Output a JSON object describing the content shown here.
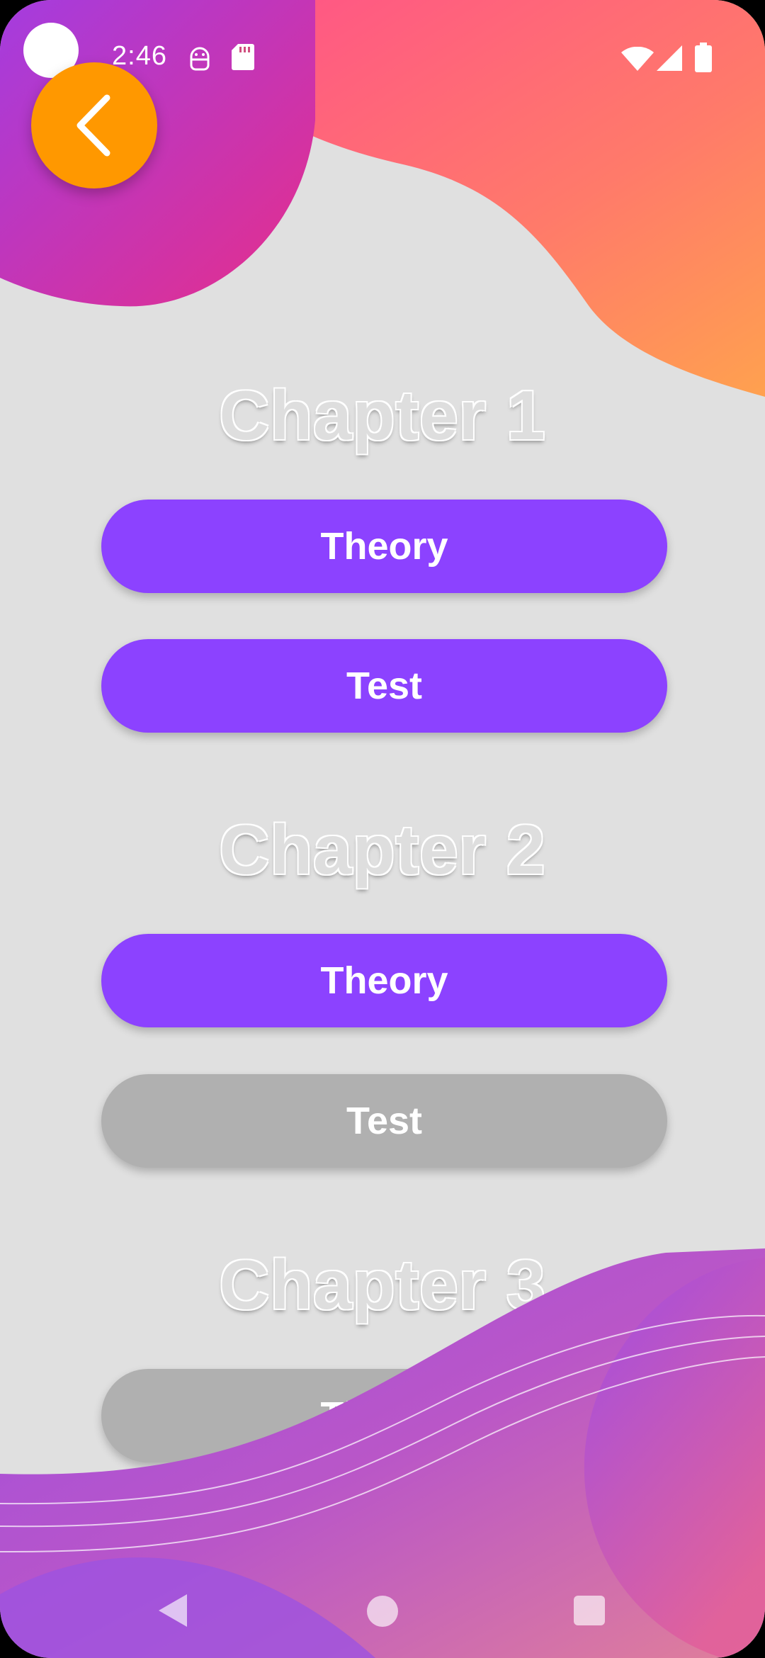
{
  "status_bar": {
    "time": "2:46"
  },
  "chapters": [
    {
      "title": "Chapter 1",
      "theory_label": "Theory",
      "test_label": "Test",
      "theory_enabled": true,
      "test_enabled": true
    },
    {
      "title": "Chapter 2",
      "theory_label": "Theory",
      "test_label": "Test",
      "theory_enabled": true,
      "test_enabled": false
    },
    {
      "title": "Chapter 3",
      "theory_label": "Theory",
      "theory_enabled": false
    }
  ],
  "colors": {
    "accent_purple": "#8c42ff",
    "disabled_gray": "#b0b0b0",
    "back_button_orange": "#ff9800",
    "background": "#e0e0e0"
  },
  "icons": {
    "back_button": "chevron-left-icon",
    "status": [
      "android-icon",
      "sd-card-icon",
      "wifi-icon",
      "signal-icon",
      "battery-icon"
    ],
    "nav": [
      "nav-back-icon",
      "nav-home-icon",
      "nav-recents-icon"
    ]
  }
}
